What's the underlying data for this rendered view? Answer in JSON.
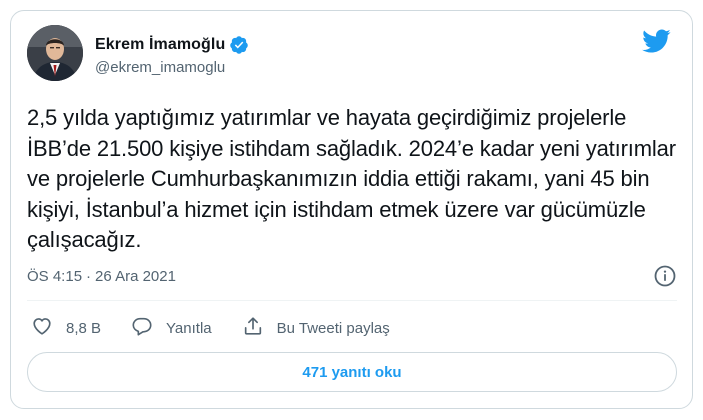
{
  "colors": {
    "accent": "#1d9bf0",
    "text_primary": "#0f1419",
    "text_secondary": "#536471",
    "border": "#cfd9de"
  },
  "author": {
    "display_name": "Ekrem İmamoğlu",
    "handle": "@ekrem_imamoglu",
    "verified_icon": "verified-badge-icon",
    "avatar_icon": "avatar"
  },
  "brand": {
    "logo_icon": "twitter-bird-icon"
  },
  "tweet": {
    "text": "2,5 yılda yaptığımız yatırımlar ve hayata geçirdiğimiz projelerle İBB’de 21.500 kişiye istihdam sağladık. 2024’e kadar yeni yatırımlar ve projelerle Cumhurbaşkanımızın iddia ettiği rakamı, yani 45 bin kişiyi, İstanbul’a hizmet için istihdam etmek üzere var gücümüzle çalışacağız.",
    "time": "ÖS 4:15",
    "separator": "·",
    "date": "26 Ara 2021",
    "info_icon": "info-icon"
  },
  "actions": {
    "like_count": "8,8 B",
    "like_icon": "heart-icon",
    "reply_label": "Yanıtla",
    "reply_icon": "speech-bubble-icon",
    "share_label": "Bu Tweeti paylaş",
    "share_icon": "share-upload-icon"
  },
  "replies": {
    "button_label": "471 yanıtı oku"
  }
}
